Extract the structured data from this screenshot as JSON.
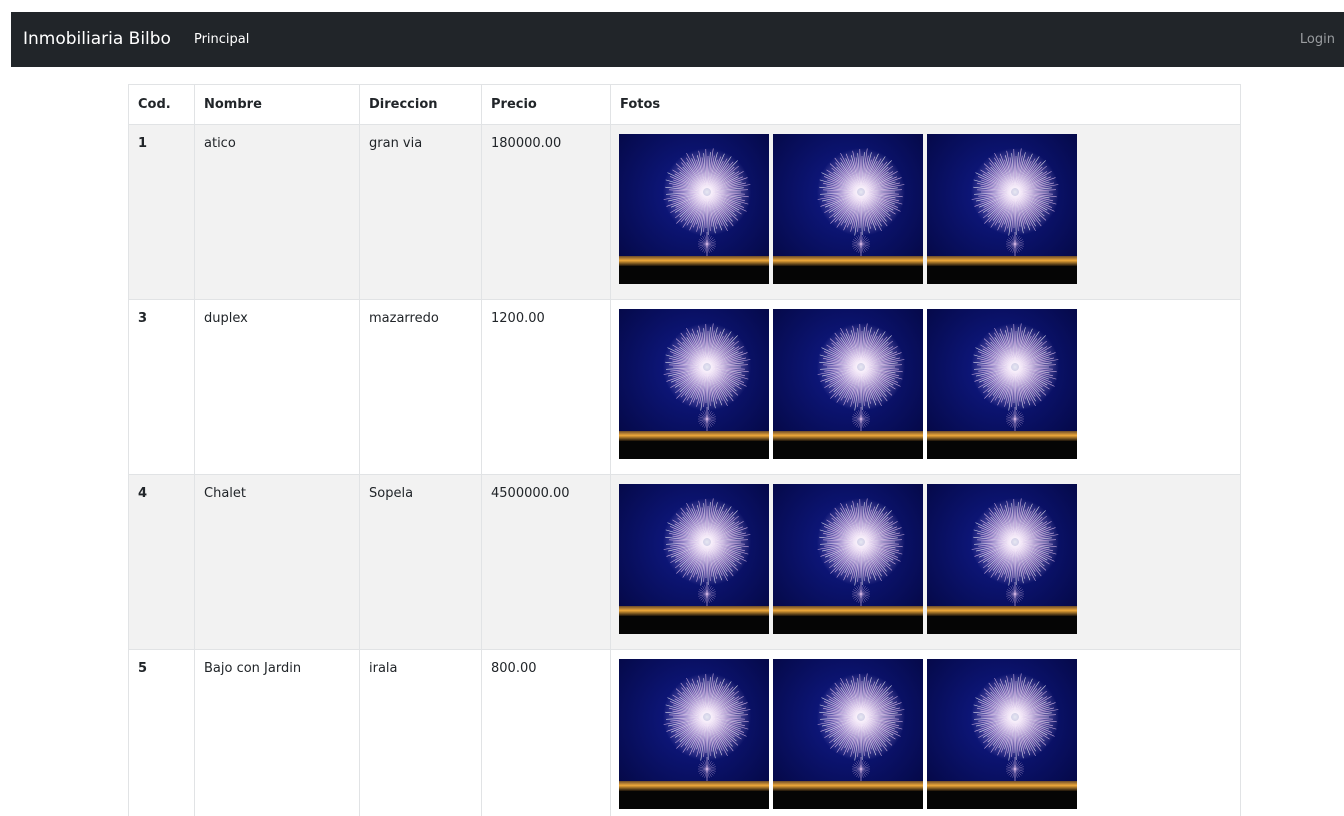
{
  "navbar": {
    "brand": "Inmobiliaria Bilbo",
    "principal": "Principal",
    "login": "Login"
  },
  "table": {
    "headers": {
      "cod": "Cod.",
      "nombre": "Nombre",
      "direccion": "Direccion",
      "precio": "Precio",
      "fotos": "Fotos"
    },
    "rows": [
      {
        "cod": "1",
        "nombre": "atico",
        "direccion": "gran via",
        "precio": "180000.00"
      },
      {
        "cod": "3",
        "nombre": "duplex",
        "direccion": "mazarredo",
        "precio": "1200.00"
      },
      {
        "cod": "4",
        "nombre": "Chalet",
        "direccion": "Sopela",
        "precio": "4500000.00"
      },
      {
        "cod": "5",
        "nombre": "Bajo con Jardin",
        "direccion": "irala",
        "precio": "800.00"
      }
    ]
  },
  "colors": {
    "navbar_bg": "#212529",
    "stripe_bg": "#f2f2f2",
    "sky_top": "#03063e",
    "sky_mid": "#101b8c",
    "firework": "#e8c6f0",
    "city_lights": "#f0a93a"
  },
  "icons": {
    "property_photo": "fireworks-photo"
  }
}
